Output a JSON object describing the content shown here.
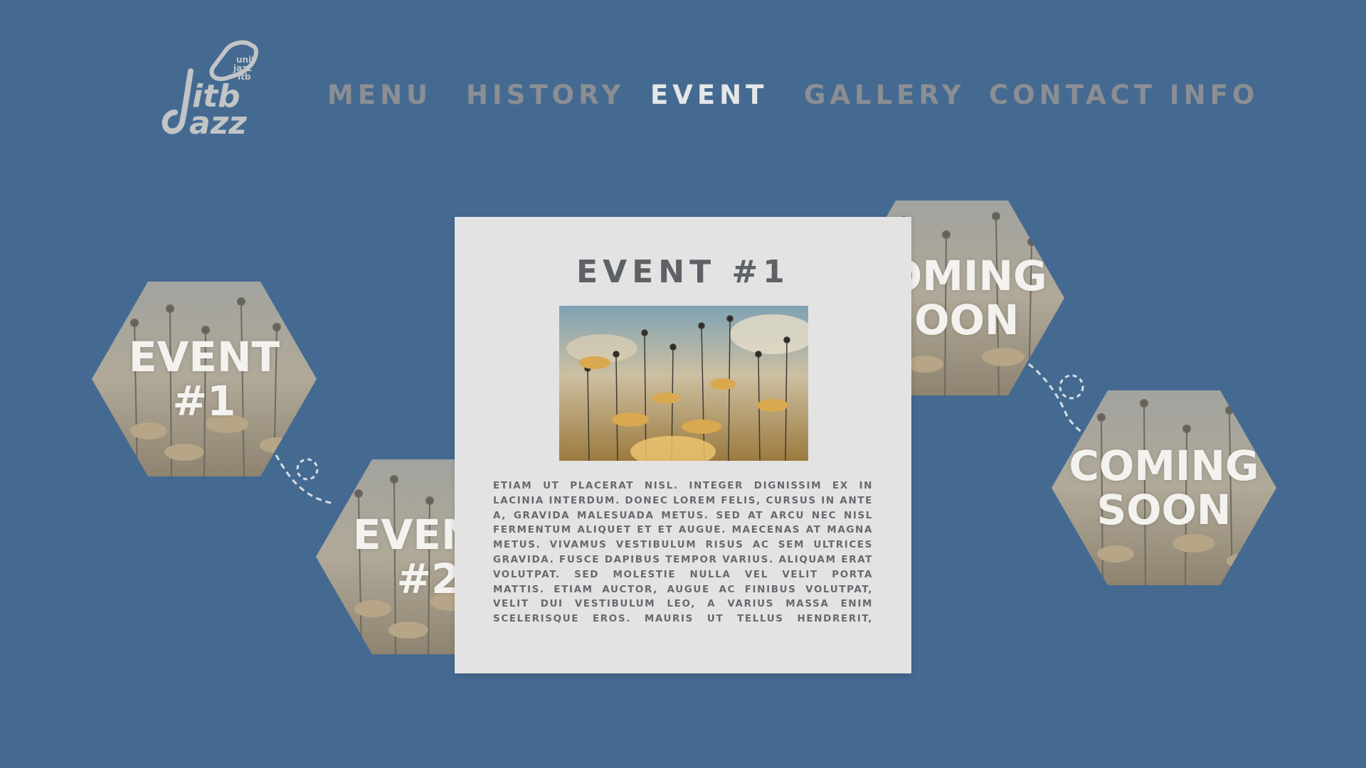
{
  "brand": {
    "logo_small_lines": [
      "unit",
      "jazz",
      "itb"
    ],
    "logo_itb": "itb",
    "logo_jazz": "azz"
  },
  "nav": {
    "items": [
      {
        "label": "MENU",
        "active": false
      },
      {
        "label": "HISTORY",
        "active": false
      },
      {
        "label": "EVENT",
        "active": true
      },
      {
        "label": "GALLERY",
        "active": false
      },
      {
        "label": "CONTACT INFO",
        "active": false
      }
    ]
  },
  "hexes": [
    {
      "line1": "EVENT",
      "line2": "#1"
    },
    {
      "line1": "EVENT",
      "line2": "#2"
    },
    {
      "line1": "COMING",
      "line2": "SOON"
    },
    {
      "line1": "COMING",
      "line2": "SOON"
    }
  ],
  "card": {
    "title": "EVENT #1",
    "body": "Etiam ut placerat nisl. Integer dignissim ex in lacinia interdum. Donec lorem felis, cursus in ante a, gravida malesuada metus. Sed at arcu nec nisl fermentum aliquet et et augue. Maecenas at magna metus. Vivamus vestibulum risus ac sem ultrices gravida. Fusce dapibus tempor varius. Aliquam erat volutpat. Sed molestie nulla vel velit porta mattis. Etiam auctor, augue ac finibus volutpat, velit dui vestibulum leo, a varius massa enim scelerisque eros. Mauris ut tellus hendrerit, imperdiet arcu pulvinar, hendrerit massa. Sed aliquet, tellus ut semper rhoncus, tellus odio accumsan ante, id"
  },
  "colors": {
    "background": "#446a91",
    "nav_inactive": "#8b8e93",
    "nav_active": "#e5e6e8",
    "card_bg": "#e3e3e4",
    "card_text": "#5e6165"
  }
}
